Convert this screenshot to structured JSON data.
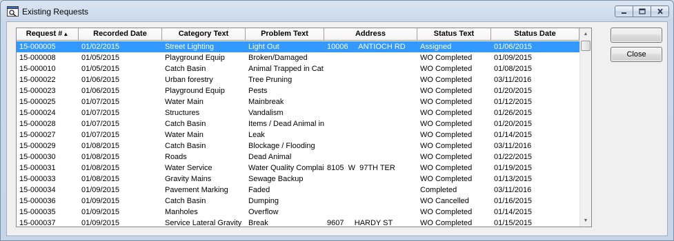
{
  "window": {
    "title": "Existing Requests",
    "controls": {
      "minimize_icon": "minimize-icon",
      "maximize_icon": "maximize-icon",
      "close_icon": "close-icon"
    }
  },
  "grid": {
    "columns": [
      "Request #",
      "Recorded Date",
      "Category Text",
      "Problem Text",
      "Address",
      "Status Text",
      "Status Date"
    ],
    "sort_indicator": "▲",
    "selected_row_index": 0,
    "rows": [
      [
        "15-000005",
        "01/02/2015",
        "Street Lighting",
        "Light Out",
        "10006     ANTIOCH RD",
        "Assigned",
        "01/06/2015"
      ],
      [
        "15-000008",
        "01/05/2015",
        "Playground Equip",
        "Broken/Damaged",
        "",
        "WO Completed",
        "01/09/2015"
      ],
      [
        "15-000010",
        "01/05/2015",
        "Catch Basin",
        "Animal Trapped in Cat",
        "",
        "WO Completed",
        "01/08/2015"
      ],
      [
        "15-000022",
        "01/06/2015",
        "Urban forestry",
        "Tree Pruning",
        "",
        "WO Completed",
        "03/11/2016"
      ],
      [
        "15-000023",
        "01/06/2015",
        "Playground Equip",
        "Pests",
        "",
        "WO Completed",
        "01/20/2015"
      ],
      [
        "15-000025",
        "01/07/2015",
        "Water Main",
        "Mainbreak",
        "",
        "WO Completed",
        "01/12/2015"
      ],
      [
        "15-000024",
        "01/07/2015",
        "Structures",
        "Vandalism",
        "",
        "WO Completed",
        "01/26/2015"
      ],
      [
        "15-000028",
        "01/07/2015",
        "Catch Basin",
        "Items / Dead Animal in",
        "",
        "WO Completed",
        "01/20/2015"
      ],
      [
        "15-000027",
        "01/07/2015",
        "Water Main",
        "Leak",
        "",
        "WO Completed",
        "01/14/2015"
      ],
      [
        "15-000029",
        "01/08/2015",
        "Catch Basin",
        "Blockage / Flooding",
        "",
        "WO Completed",
        "03/11/2016"
      ],
      [
        "15-000030",
        "01/08/2015",
        "Roads",
        "Dead Animal",
        "",
        "WO Completed",
        "01/22/2015"
      ],
      [
        "15-000031",
        "01/08/2015",
        "Water Service",
        "Water Quality Complai",
        "8105  W  97TH TER",
        "WO Completed",
        "01/19/2015"
      ],
      [
        "15-000033",
        "01/08/2015",
        "Gravity Mains",
        "Sewage Backup",
        "",
        "WO Completed",
        "01/13/2015"
      ],
      [
        "15-000034",
        "01/09/2015",
        "Pavement Marking",
        "Faded",
        "",
        "Completed",
        "03/11/2016"
      ],
      [
        "15-000036",
        "01/09/2015",
        "Catch Basin",
        "Dumping",
        "",
        "WO Cancelled",
        "01/16/2015"
      ],
      [
        "15-000035",
        "01/09/2015",
        "Manholes",
        "Overflow",
        "",
        "WO Completed",
        "01/14/2015"
      ],
      [
        "15-000037",
        "01/09/2015",
        "Service Lateral Gravity",
        "Break",
        "9607     HARDY ST",
        "WO Completed",
        "01/15/2015"
      ]
    ]
  },
  "buttons": {
    "blank_label": "",
    "close_label": "Close"
  },
  "colors": {
    "selection": "#3399ff",
    "window_frame": "#c9d8ea"
  }
}
